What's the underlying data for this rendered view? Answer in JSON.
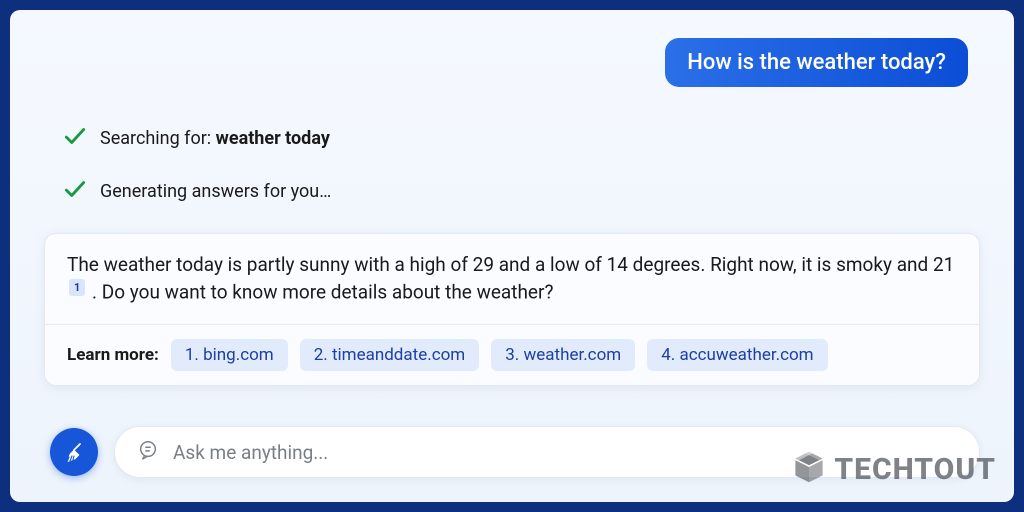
{
  "user_message": "How is the weather today?",
  "status": {
    "searching_label": "Searching for: ",
    "searching_query": "weather today",
    "generating_label": "Generating answers for you…"
  },
  "answer": {
    "text_part1": "The weather today is partly sunny with a high of 29 and a low of 14 degrees. Right now, it is smoky and 21",
    "citation": "1",
    "text_part2": ". Do you want to know more details about the weather?"
  },
  "learn_more": {
    "label": "Learn more:",
    "sources": [
      {
        "prefix": "1.",
        "domain": "bing.com"
      },
      {
        "prefix": "2.",
        "domain": "timeanddate.com"
      },
      {
        "prefix": "3.",
        "domain": "weather.com"
      },
      {
        "prefix": "4.",
        "domain": "accuweather.com"
      }
    ]
  },
  "input": {
    "placeholder": "Ask me anything..."
  },
  "watermark": "TECHTOUT"
}
